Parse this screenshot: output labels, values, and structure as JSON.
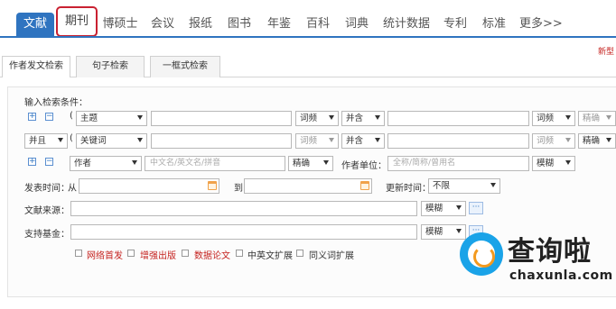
{
  "nav": {
    "tabs": [
      "文献",
      "期刊",
      "博硕士",
      "会议",
      "报纸",
      "图书",
      "年鉴",
      "百科",
      "词典",
      "统计数据",
      "专利",
      "标准",
      "更多>>"
    ],
    "active": "文献",
    "highlighted": "期刊"
  },
  "corner_link": "新型",
  "subtabs": [
    "作者发文检索",
    "句子检索",
    "一框式检索"
  ],
  "search": {
    "header": "输入检索条件：",
    "row1": {
      "open_paren": "(",
      "field": "主题",
      "freq": "词频",
      "logic": "并含",
      "freq2": "词频",
      "match": "精确"
    },
    "row2": {
      "conj": "并且",
      "open_paren": "(",
      "field": "关键词",
      "freq": "词频",
      "logic": "并含",
      "freq2": "词频",
      "match": "精确"
    },
    "row3": {
      "field": "作者",
      "placeholder": "中文名/英文名/拼音",
      "match": "精确",
      "unit_label": "作者单位：",
      "unit_placeholder": "全称/简称/曾用名",
      "unit_match": "模糊"
    },
    "date": {
      "label": "发表时间：",
      "from": "从",
      "to": "到",
      "update_label": "更新时间：",
      "update_value": "不限"
    },
    "source": {
      "label": "文献来源：",
      "match": "模糊",
      "more": "···"
    },
    "fund": {
      "label": "支持基金：",
      "match": "模糊",
      "more": "···"
    },
    "options": [
      "网络首发",
      "增强出版",
      "数据论文",
      "中英文扩展",
      "同义词扩展"
    ],
    "plus": "+",
    "minus": "−"
  },
  "watermark": {
    "title": "查询啦",
    "url": "chaxunla.com"
  },
  "colors": {
    "accent": "#2f74c0",
    "highlight": "#c92131",
    "red_option": "#c5221f"
  }
}
